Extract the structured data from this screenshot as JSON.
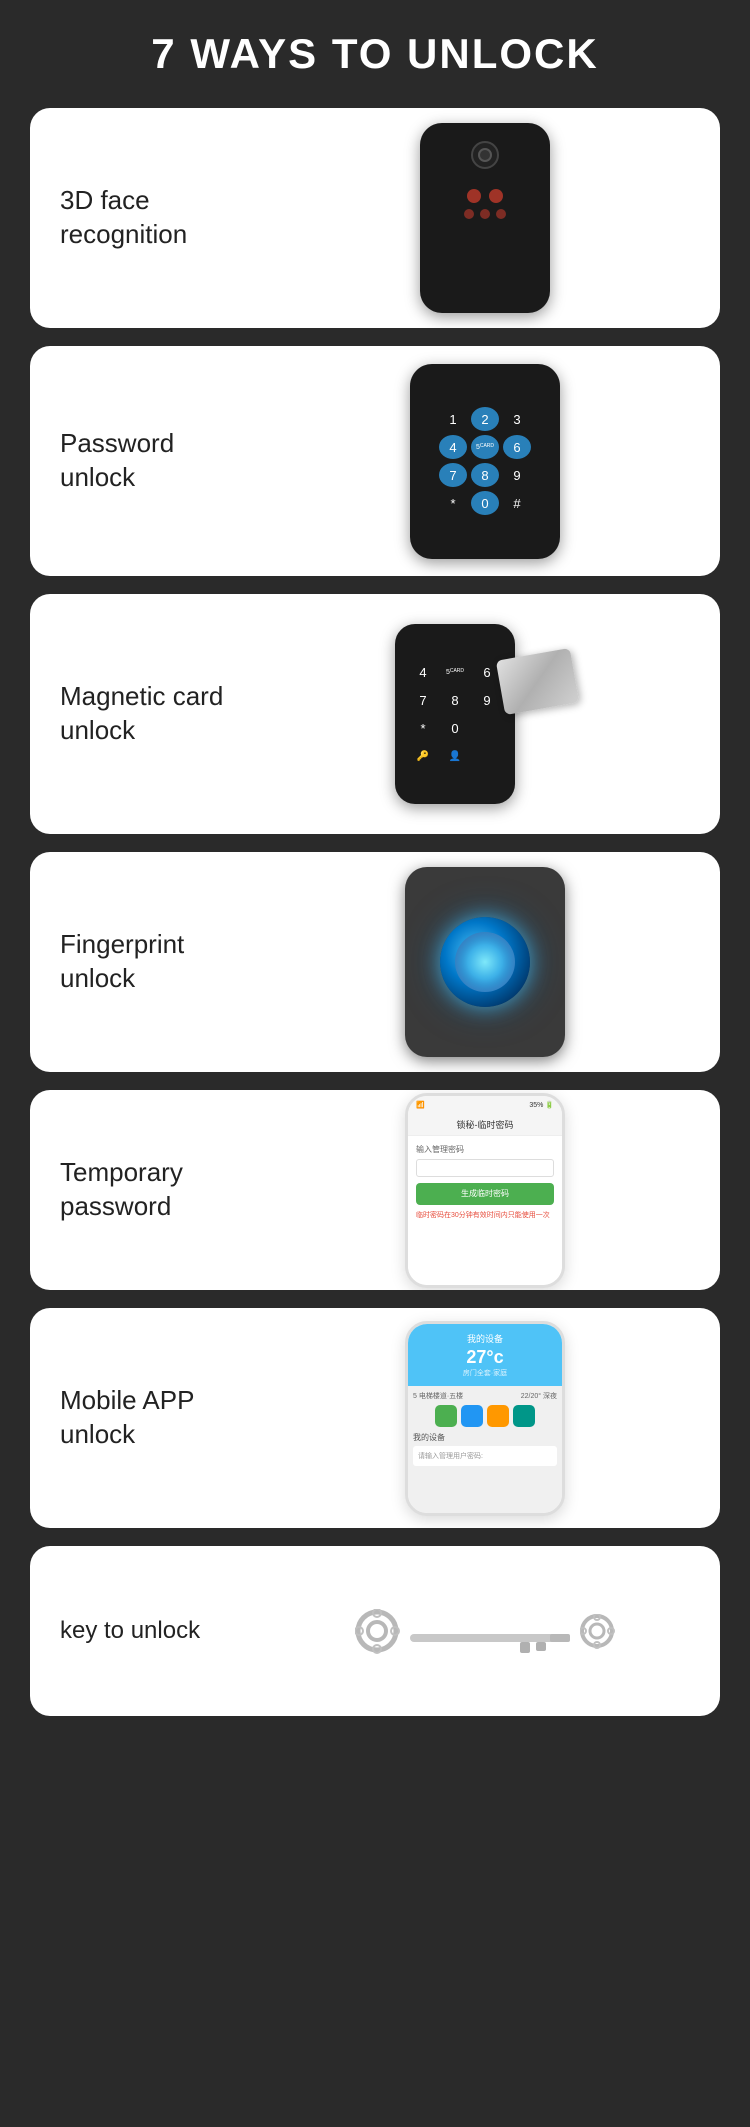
{
  "page": {
    "title": "7 WAYS TO UNLOCK",
    "background": "#2a2a2a"
  },
  "cards": [
    {
      "id": "card-face",
      "label": "3D face\nrecognition",
      "label_line1": "3D face",
      "label_line2": "recognition"
    },
    {
      "id": "card-password",
      "label": "Password\nunlock",
      "label_line1": "Password",
      "label_line2": "unlock"
    },
    {
      "id": "card-magnetic",
      "label": "Magnetic card\nunlock",
      "label_line1": "Magnetic card",
      "label_line2": "unlock"
    },
    {
      "id": "card-fingerprint",
      "label": "Fingerprint\nunlock",
      "label_line1": "Fingerprint",
      "label_line2": "unlock"
    },
    {
      "id": "card-temp",
      "label": "Temporary\npassword",
      "label_line1": "Temporary",
      "label_line2": "password",
      "phone": {
        "header": "锁秘-临时密码",
        "input_label": "输入管理密码",
        "button": "生成临时密码",
        "note": "临时密码在30分钟有效时间内只能使用一次"
      }
    },
    {
      "id": "card-app",
      "label": "Mobile APP\nunlock",
      "label_line1": "Mobile APP",
      "label_line2": "unlock",
      "phone": {
        "header": "我的设备",
        "temperature": "27°c",
        "sub": "房门全套·家庭",
        "input_placeholder": "请输入管理用户密码:"
      }
    },
    {
      "id": "card-key",
      "label": "key to unlock"
    }
  ],
  "keypad": {
    "keys": [
      "1",
      "2",
      "3",
      "4",
      "5",
      "6",
      "7",
      "8",
      "9",
      "*",
      "0",
      "#"
    ],
    "highlighted": [
      1,
      3,
      5,
      6,
      7,
      9
    ],
    "card_key_index": 4
  }
}
